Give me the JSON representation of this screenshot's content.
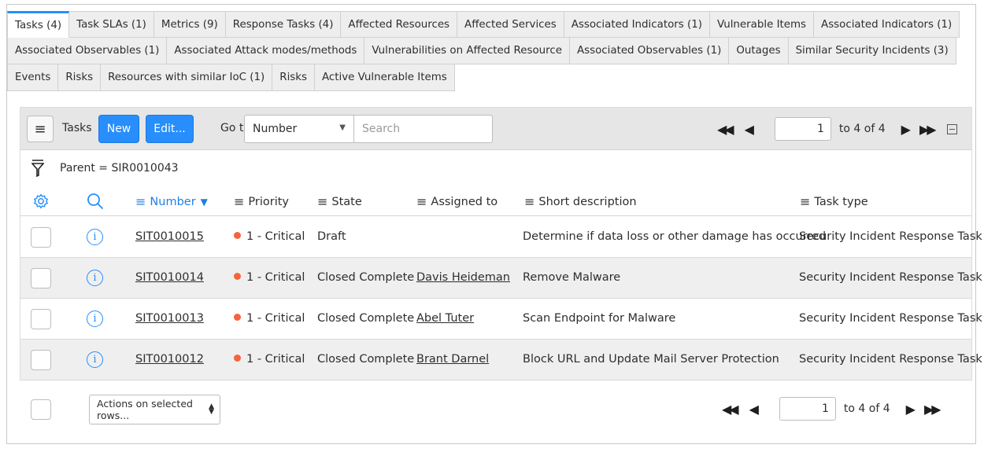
{
  "tabs": {
    "row1": [
      "Tasks (4)",
      "Task SLAs (1)",
      "Metrics (9)",
      "Response Tasks (4)",
      "Affected Resources",
      "Affected Services",
      "Associated Indicators (1)",
      "Vulnerable Items",
      "Associated Indicators (1)"
    ],
    "row2": [
      "Associated Observables (1)",
      "Associated Attack modes/methods",
      "Vulnerabilities on Affected Resource",
      "Associated Observables (1)",
      "Outages",
      "Similar Security Incidents (3)"
    ],
    "row3": [
      "Events",
      "Risks",
      "Resources with similar IoC (1)",
      "Risks",
      "Active Vulnerable Items"
    ]
  },
  "toolbar": {
    "title": "Tasks",
    "new_label": "New",
    "edit_label": "Edit...",
    "goto_label": "Go to",
    "goto_field": "Number",
    "search_placeholder": "Search",
    "page": "1",
    "page_range": "to 4 of 4"
  },
  "filter": {
    "text": "Parent = SIR0010043"
  },
  "columns": {
    "number": "Number",
    "priority": "Priority",
    "state": "State",
    "assigned_to": "Assigned to",
    "short_description": "Short description",
    "task_type": "Task type"
  },
  "rows": [
    {
      "number": "SIT0010015",
      "priority": "1 - Critical",
      "state": "Draft",
      "assigned_to": "",
      "short_description": "Determine if data loss or other damage has occurred",
      "task_type": "Security Incident Response Task"
    },
    {
      "number": "SIT0010014",
      "priority": "1 - Critical",
      "state": "Closed Complete",
      "assigned_to": "Davis Heideman",
      "short_description": "Remove Malware",
      "task_type": "Security Incident Response Task"
    },
    {
      "number": "SIT0010013",
      "priority": "1 - Critical",
      "state": "Closed Complete",
      "assigned_to": "Abel Tuter",
      "short_description": "Scan Endpoint for Malware",
      "task_type": "Security Incident Response Task"
    },
    {
      "number": "SIT0010012",
      "priority": "1 - Critical",
      "state": "Closed Complete",
      "assigned_to": "Brant Darnel",
      "short_description": "Block URL and Update Mail Server Protection",
      "task_type": "Security Incident Response Task"
    }
  ],
  "footer": {
    "actions_label": "Actions on selected rows...",
    "page": "1",
    "page_range": "to 4 of 4"
  },
  "colors": {
    "accent": "#278efc",
    "critical": "#f5643a"
  }
}
